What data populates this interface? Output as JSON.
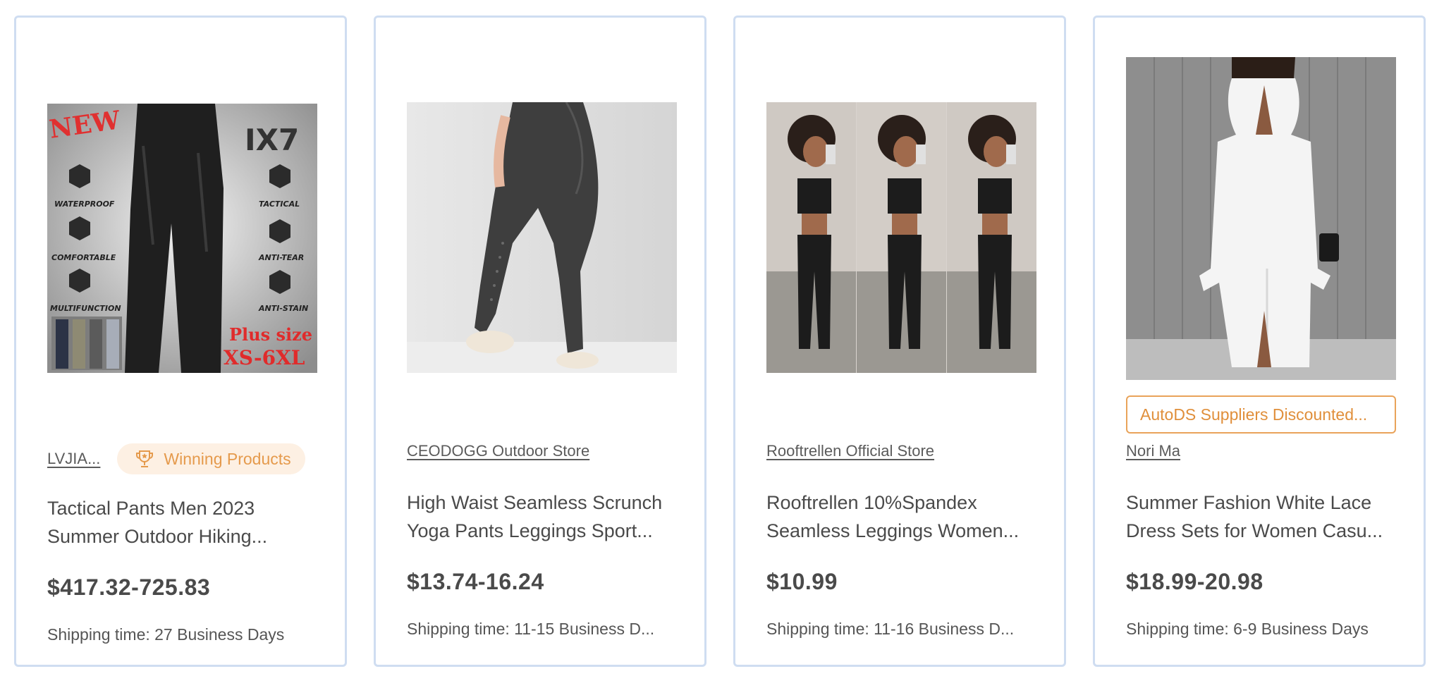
{
  "products": [
    {
      "image_alt": "Tactical pants product image",
      "image_text": {
        "new": "NEW",
        "brand": "IX7",
        "features": [
          "WATERPROOF",
          "COMFORTABLE",
          "MULTIFUNCTION",
          "TACTICAL",
          "ANTI-TEAR",
          "ANTI-STAIN"
        ],
        "plus": "Plus size",
        "sizes": "XS-6XL"
      },
      "store": "LVJIA...",
      "badge": "Winning Products",
      "title_line1": "Tactical Pants Men 2023",
      "title_line2": "Summer Outdoor Hiking...",
      "price": "$417.32-725.83",
      "shipping": "Shipping time: 27 Business Days"
    },
    {
      "image_alt": "Grey yoga leggings product image",
      "store": "CEODOGG Outdoor Store",
      "title_line1": "High Waist Seamless Scrunch",
      "title_line2": "Yoga Pants Leggings Sport...",
      "price": "$13.74-16.24",
      "shipping": "Shipping time: 11-15 Business D..."
    },
    {
      "image_alt": "Black sports bra and leggings product image",
      "store": "Rooftrellen Official Store",
      "title_line1": "Rooftrellen 10%Spandex",
      "title_line2": "Seamless Leggings Women...",
      "price": "$10.99",
      "shipping": "Shipping time: 11-16 Business D..."
    },
    {
      "image_alt": "White lace dress product image",
      "discount_badge": "AutoDS Suppliers Discounted...",
      "store": "Nori Ma",
      "title_line1": "Summer Fashion White Lace",
      "title_line2": "Dress Sets for Women Casu...",
      "price": "$18.99-20.98",
      "shipping": "Shipping time: 6-9 Business Days"
    }
  ],
  "colors": {
    "card_border": "#cfddf1",
    "winning_bg": "#fdf0e3",
    "winning_text": "#e59a4c",
    "discount_border": "#e9a35a",
    "text": "#4a4a4a"
  },
  "icons": {
    "winning": "trophy-icon"
  }
}
